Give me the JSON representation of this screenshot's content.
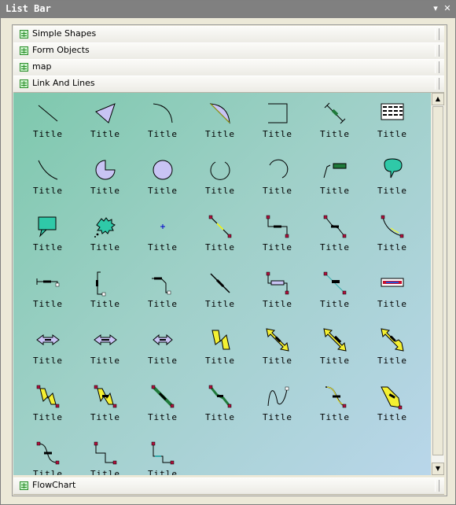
{
  "window": {
    "title": "List Bar",
    "pin_icon": "pin-down-icon",
    "close_icon": "close-icon"
  },
  "bars_top": [
    {
      "label": "Simple Shapes",
      "icon": "grid-icon"
    },
    {
      "label": "Form Objects",
      "icon": "grid-icon"
    },
    {
      "label": "map",
      "icon": "grid-icon"
    },
    {
      "label": "Link And Lines",
      "icon": "grid-icon"
    }
  ],
  "bars_bottom": [
    {
      "label": "FlowChart",
      "icon": "grid-icon"
    }
  ],
  "items": [
    {
      "label": "Title",
      "icon": "diagonal-line-icon"
    },
    {
      "label": "Title",
      "icon": "filled-triangle-icon"
    },
    {
      "label": "Title",
      "icon": "arc-icon"
    },
    {
      "label": "Title",
      "icon": "filled-arc-segment-icon"
    },
    {
      "label": "Title",
      "icon": "elbow-line-icon"
    },
    {
      "label": "Title",
      "icon": "dimension-line-icon"
    },
    {
      "label": "Title",
      "icon": "table-grid-icon"
    },
    {
      "label": "Title",
      "icon": "curve-line-icon"
    },
    {
      "label": "Title",
      "icon": "pie-shape-icon"
    },
    {
      "label": "Title",
      "icon": "chord-shape-icon"
    },
    {
      "label": "Title",
      "icon": "open-arc-icon"
    },
    {
      "label": "Title",
      "icon": "open-arc-alt-icon"
    },
    {
      "label": "Title",
      "icon": "callout-line-icon"
    },
    {
      "label": "Title",
      "icon": "callout-bubble-icon"
    },
    {
      "label": "Title",
      "icon": "speech-callout-icon"
    },
    {
      "label": "Title",
      "icon": "thought-callout-icon"
    },
    {
      "label": "Title",
      "icon": "crosshair-point-icon"
    },
    {
      "label": "Title",
      "icon": "link-straight-icon"
    },
    {
      "label": "Title",
      "icon": "link-orthogonal-icon"
    },
    {
      "label": "Title",
      "icon": "link-segmented-icon"
    },
    {
      "label": "Title",
      "icon": "link-curved-icon"
    },
    {
      "label": "Title",
      "icon": "link-hook-icon"
    },
    {
      "label": "Title",
      "icon": "link-bracket-icon"
    },
    {
      "label": "Title",
      "icon": "link-step-icon"
    },
    {
      "label": "Title",
      "icon": "link-dashed-icon"
    },
    {
      "label": "Title",
      "icon": "link-labeled-orthogonal-icon"
    },
    {
      "label": "Title",
      "icon": "link-labeled-diagonal-icon"
    },
    {
      "label": "Title",
      "icon": "text-label-icon"
    },
    {
      "label": "Title",
      "icon": "double-arrow-icon"
    },
    {
      "label": "Title",
      "icon": "double-arrow-alt-icon"
    },
    {
      "label": "Title",
      "icon": "double-arrow-short-icon"
    },
    {
      "label": "Title",
      "icon": "lightning-icon"
    },
    {
      "label": "Title",
      "icon": "diagonal-double-arrow-icon"
    },
    {
      "label": "Title",
      "icon": "diagonal-double-arrow-alt-icon"
    },
    {
      "label": "Title",
      "icon": "diagonal-double-arrow-bent-icon"
    },
    {
      "label": "Title",
      "icon": "lightning-link-icon"
    },
    {
      "label": "Title",
      "icon": "lightning-link-alt-icon"
    },
    {
      "label": "Title",
      "icon": "thick-link-icon"
    },
    {
      "label": "Title",
      "icon": "thick-link-alt-icon"
    },
    {
      "label": "Title",
      "icon": "bezier-curve-icon"
    },
    {
      "label": "Title",
      "icon": "bezier-link-icon"
    },
    {
      "label": "Title",
      "icon": "arrow-link-icon"
    },
    {
      "label": "Title",
      "icon": "s-curve-link-icon"
    },
    {
      "label": "Title",
      "icon": "step-link-icon"
    },
    {
      "label": "Title",
      "icon": "step-link-alt-icon"
    }
  ],
  "scrollbar": {
    "up_glyph": "▲",
    "down_glyph": "▼"
  },
  "colors": {
    "panel_start": "#7ec8ad",
    "panel_end": "#b9d6ea",
    "shape_fill": "#c8c4f4",
    "arrow_fill": "#f4f032",
    "link_green": "#1f7a3a",
    "end_red": "#b0103c"
  }
}
